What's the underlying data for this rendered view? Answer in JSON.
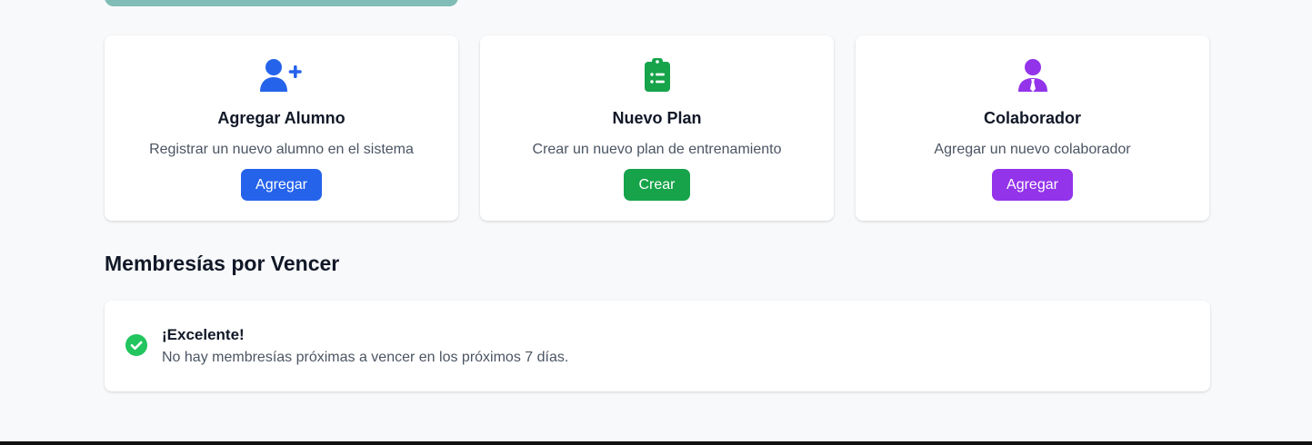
{
  "quick_actions": [
    {
      "title": "Agregar Alumno",
      "description": "Registrar un nuevo alumno en el sistema",
      "button_label": "Agregar",
      "icon": "user-plus-icon",
      "color": "#2563eb"
    },
    {
      "title": "Nuevo Plan",
      "description": "Crear un nuevo plan de entrenamiento",
      "button_label": "Crear",
      "icon": "clipboard-list-icon",
      "color": "#16a34a"
    },
    {
      "title": "Colaborador",
      "description": "Agregar un nuevo colaborador",
      "button_label": "Agregar",
      "icon": "user-tie-icon",
      "color": "#9333ea"
    }
  ],
  "expiring_section": {
    "title": "Membresías por Vencer",
    "notice_title": "¡Excelente!",
    "notice_text": "No hay membresías próximas a vencer en los próximos 7 días.",
    "notice_icon": "check-circle-icon",
    "notice_color": "#22c55e"
  }
}
